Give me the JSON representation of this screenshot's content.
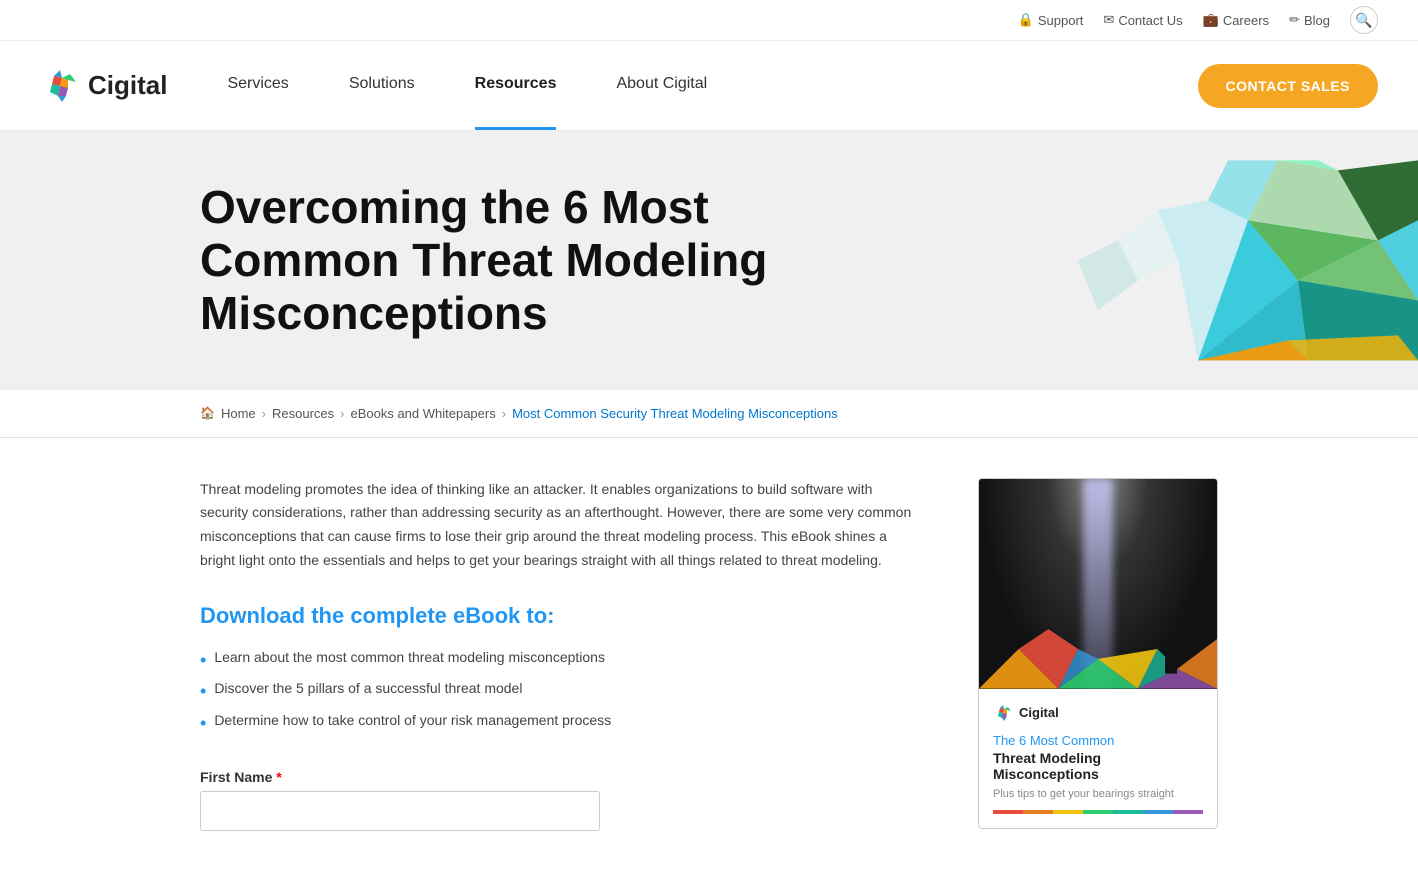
{
  "topbar": {
    "support_label": "Support",
    "contact_us_label": "Contact Us",
    "careers_label": "Careers",
    "blog_label": "Blog"
  },
  "nav": {
    "logo_text": "Cigital",
    "links": [
      {
        "label": "Services",
        "active": false
      },
      {
        "label": "Solutions",
        "active": false
      },
      {
        "label": "Resources",
        "active": true
      },
      {
        "label": "About Cigital",
        "active": false
      }
    ],
    "cta_label": "CONTACT SALES"
  },
  "hero": {
    "title": "Overcoming the 6 Most Common Threat Modeling Misconceptions"
  },
  "breadcrumb": {
    "home": "Home",
    "resources": "Resources",
    "ebooks": "eBooks and Whitepapers",
    "current": "Most Common Security Threat Modeling Misconceptions"
  },
  "content": {
    "body_text": "Threat modeling promotes the idea of thinking like an attacker. It enables organizations to build software with security considerations, rather than addressing security as an afterthought. However, there are some very common misconceptions that can cause firms to lose their grip around the threat modeling process. This eBook shines a bright light onto the essentials and helps to get your bearings straight with all things related to threat modeling.",
    "download_heading": "Download the complete eBook to:",
    "bullets": [
      "Learn about the most common threat modeling misconceptions",
      "Discover the 5 pillars of a successful threat model",
      "Determine how to take control of your risk management process"
    ],
    "form": {
      "first_name_label": "First Name",
      "required_marker": "*"
    }
  },
  "book_card": {
    "logo_text": "Cigital",
    "title_line1": "The 6 Most Common",
    "title_line2": "Threat Modeling Misconceptions",
    "subtitle": "Plus tips to get your bearings straight",
    "color_bar": [
      "#e74c3c",
      "#e67e22",
      "#f1c40f",
      "#2ecc71",
      "#1abc9c",
      "#3498db",
      "#9b59b6"
    ]
  },
  "colors": {
    "accent_blue": "#2196F3",
    "accent_orange": "#f5a623",
    "nav_active_underline": "#2196F3"
  }
}
